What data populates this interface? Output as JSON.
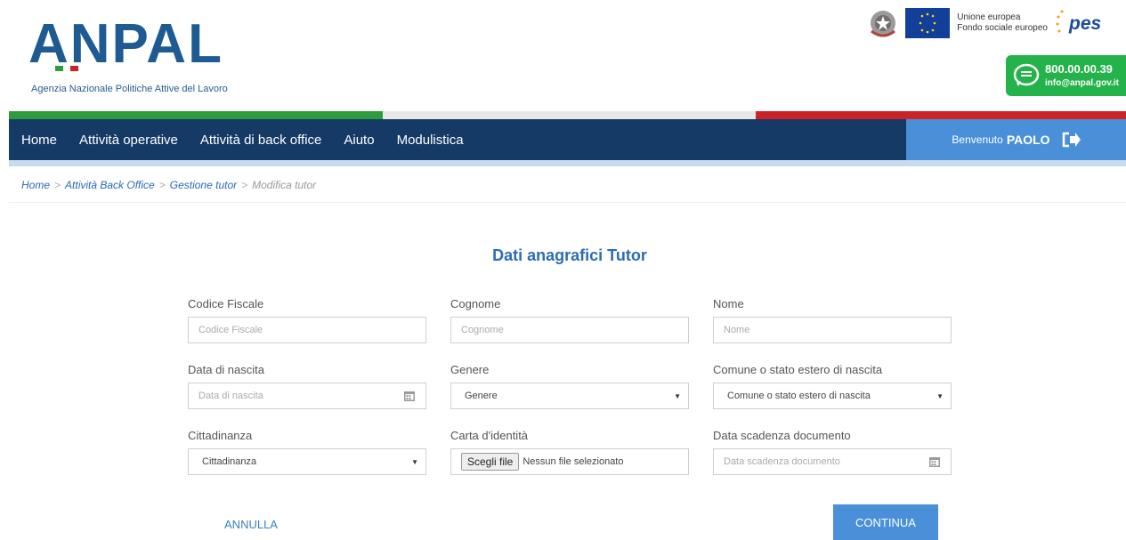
{
  "header": {
    "brand": "ANPAL",
    "brand_subtitle": "Agenzia Nazionale Politiche Attive del Lavoro",
    "eu_line1": "Unione europea",
    "eu_line2": "Fondo sociale europeo",
    "pes_label": "pes",
    "contact_phone": "800.00.00.39",
    "contact_email": "info@anpal.gov.it"
  },
  "nav": {
    "items": [
      "Home",
      "Attività operative",
      "Attività di back office",
      "Aiuto",
      "Modulistica"
    ],
    "welcome_prefix": "Benvenuto",
    "user_name": "PAOLO"
  },
  "breadcrumb": {
    "items": [
      "Home",
      "Attività Back Office",
      "Gestione tutor"
    ],
    "separator": ">",
    "current": "Modifica tutor"
  },
  "form": {
    "title": "Dati anagrafici Tutor",
    "fields": {
      "codice_fiscale": {
        "label": "Codice Fiscale",
        "placeholder": "Codice Fiscale"
      },
      "cognome": {
        "label": "Cognome",
        "placeholder": "Cognome"
      },
      "nome": {
        "label": "Nome",
        "placeholder": "Nome"
      },
      "data_nascita": {
        "label": "Data di nascita",
        "placeholder": "Data di nascita"
      },
      "genere": {
        "label": "Genere",
        "value": "Genere"
      },
      "comune_nascita": {
        "label": "Comune o stato estero di nascita",
        "value": "Comune o stato estero di nascita"
      },
      "cittadinanza": {
        "label": "Cittadinanza",
        "value": "Cittadinanza"
      },
      "carta_identita": {
        "label": "Carta d'identità",
        "button": "Scegli file",
        "status": "Nessun file selezionato"
      },
      "data_scadenza": {
        "label": "Data scadenza documento",
        "placeholder": "Data scadenza documento"
      }
    },
    "cancel_label": "ANNULLA",
    "continue_label": "CONTINUA"
  },
  "colors": {
    "nav_bg": "#153a66",
    "accent": "#4a90d9",
    "title_blue": "#2b6cb6",
    "green": "#24b24a",
    "flag_green": "#2c9c3c",
    "flag_red": "#cc2426"
  }
}
